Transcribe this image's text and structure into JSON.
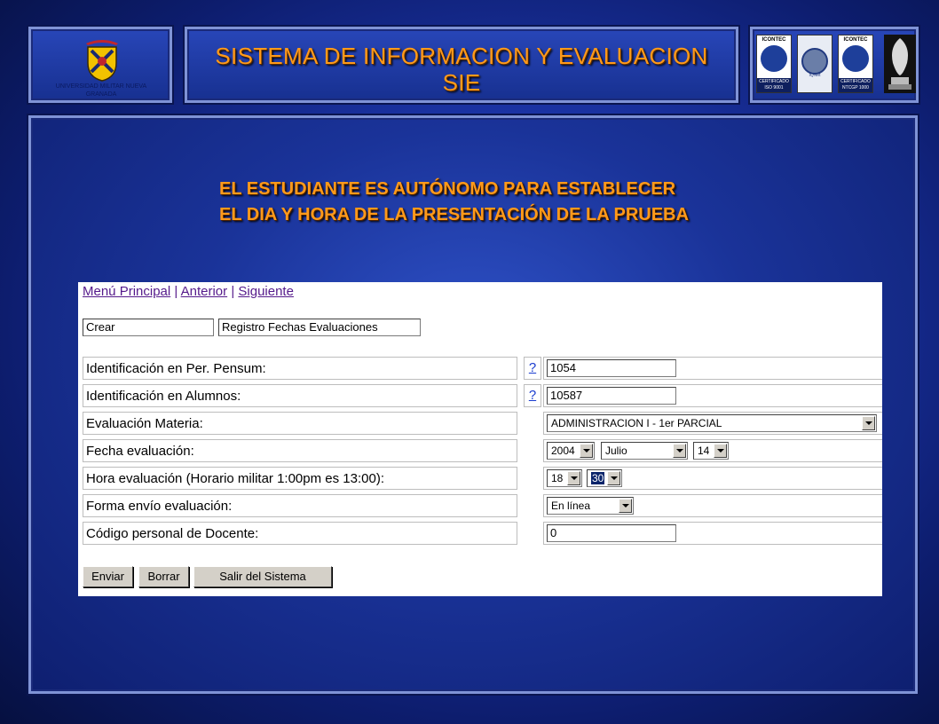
{
  "header": {
    "title_line1": "SISTEMA DE INFORMACION  Y  EVALUACION",
    "title_line2": "SIE",
    "logo_caption": "UNIVERSIDAD MILITAR NUEVA GRANADA"
  },
  "certs": [
    {
      "top": "ICONTEC",
      "bottom": "CERTIFICADO ISO 9001"
    },
    {
      "top": "",
      "bottom": "IQNet"
    },
    {
      "top": "ICONTEC",
      "bottom": "CERTIFICADO NTCGP 1000"
    }
  ],
  "note": {
    "line1": "EL  ESTUDIANTE ES AUTÓNOMO  PARA ESTABLECER",
    "line2": "EL  DIA  Y  HORA DE  LA PRESENTACIÓN DE LA  PRUEBA"
  },
  "form": {
    "menu": {
      "principal": "Menú Principal",
      "sep": " | ",
      "anterior": "Anterior",
      "siguiente": "Siguiente"
    },
    "mode_value": "Crear",
    "section_value": "Registro Fechas Evaluaciones",
    "help_glyph": "?",
    "rows": [
      {
        "label": "Identificación en Per. Pensum:",
        "value": "1054"
      },
      {
        "label": "Identificación en Alumnos:",
        "value": "10587"
      },
      {
        "label": "Evaluación Materia:",
        "value": "ADMINISTRACION I - 1er PARCIAL"
      },
      {
        "label": "Fecha evaluación:",
        "year": "2004",
        "month": "Julio",
        "day": "14"
      },
      {
        "label": "Hora evaluación (Horario militar 1:00pm es 13:00):",
        "hour": "18",
        "minute": "30"
      },
      {
        "label": "Forma envío evaluación:",
        "value": "En línea"
      },
      {
        "label": "Código personal de Docente:",
        "value": "0"
      }
    ],
    "buttons": {
      "send": "Enviar",
      "clear": "Borrar",
      "exit": "Salir del Sistema"
    }
  }
}
